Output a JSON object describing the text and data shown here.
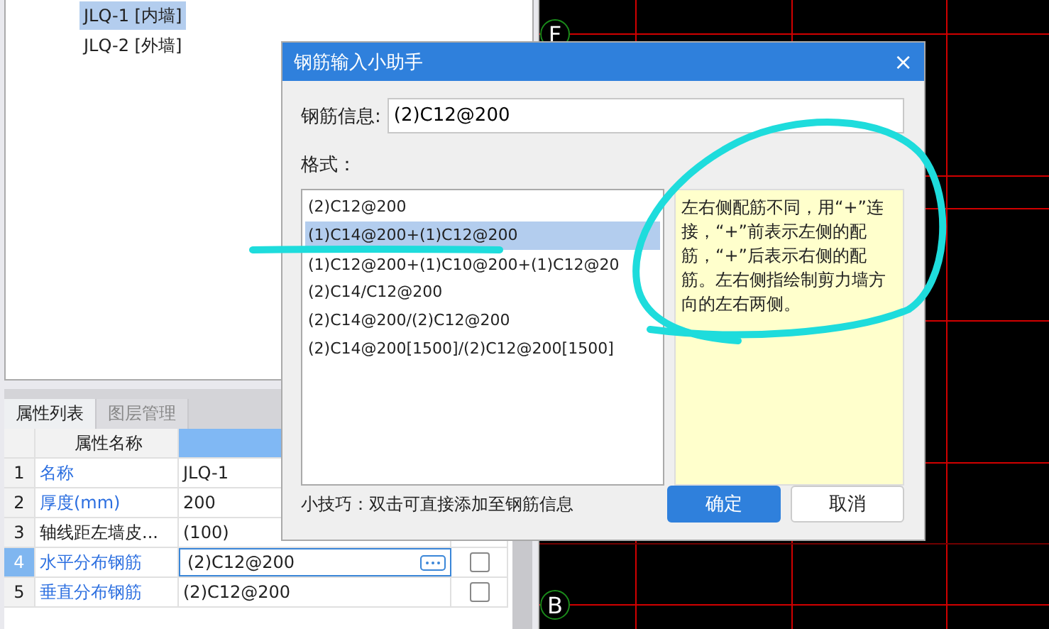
{
  "tree": {
    "items": [
      {
        "label": "JLQ-1 [内墙]",
        "selected": true
      },
      {
        "label": "JLQ-2 [外墙]",
        "selected": false
      }
    ]
  },
  "tabs": [
    {
      "label": "属性列表",
      "selected": true
    },
    {
      "label": "图层管理",
      "selected": false
    }
  ],
  "table": {
    "columns": [
      "属性名称"
    ],
    "rows": [
      {
        "index": "1",
        "name": "名称",
        "value": "JLQ-1",
        "selected": false,
        "kind": "blue"
      },
      {
        "index": "2",
        "name": "厚度(mm)",
        "value": "200",
        "selected": false,
        "kind": "blue"
      },
      {
        "index": "3",
        "name": "轴线距左墙皮...",
        "value": "(100)",
        "selected": false,
        "kind": "plain"
      },
      {
        "index": "4",
        "name": "水平分布钢筋",
        "value": "(2)C12@200",
        "selected": true,
        "kind": "blue",
        "checked": false
      },
      {
        "index": "5",
        "name": "垂直分布钢筋",
        "value": "(2)C12@200",
        "selected": false,
        "kind": "blue",
        "checked": false
      }
    ]
  },
  "canvas": {
    "axis_labels": [
      {
        "label": "F"
      },
      {
        "label": "B"
      }
    ]
  },
  "dialog": {
    "title": "钢筋输入小助手",
    "close": "×",
    "field": {
      "label": "钢筋信息:",
      "value": "(2)C12@200"
    },
    "format_label": "格式：",
    "formats": [
      {
        "label": "(2)C12@200",
        "selected": false
      },
      {
        "label": "(1)C14@200+(1)C12@200",
        "selected": true
      },
      {
        "label": "(1)C12@200+(1)C10@200+(1)C12@20",
        "selected": false
      },
      {
        "label": "(2)C14/C12@200",
        "selected": false
      },
      {
        "label": "(2)C14@200/(2)C12@200",
        "selected": false
      },
      {
        "label": "(2)C14@200[1500]/(2)C12@200[1500]",
        "selected": false
      }
    ],
    "note": "左右侧配筋不同，用“+”连接，“+”前表示左侧的配筋，“+”后表示右侧的配筋。左右侧指绘制剪力墙方向的左右两侧。",
    "tip": "小技巧：双击可直接添加至钢筋信息",
    "buttons": [
      {
        "label": "确定",
        "kind": "primary"
      },
      {
        "label": "取消",
        "kind": "secondary"
      }
    ]
  }
}
